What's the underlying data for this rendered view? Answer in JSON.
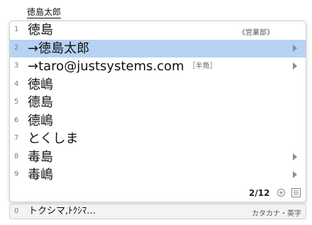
{
  "composition": "徳島太郎",
  "candidates": [
    {
      "num": "1",
      "text": "徳島",
      "annotation": "",
      "note": "《営業部》",
      "has_submenu": false,
      "selected": false
    },
    {
      "num": "2",
      "text": "→徳島太郎",
      "annotation": "",
      "note": "",
      "has_submenu": true,
      "selected": true
    },
    {
      "num": "3",
      "text": "→taro@justsystems.com",
      "annotation": "［半角］",
      "note": "",
      "has_submenu": true,
      "selected": false
    },
    {
      "num": "4",
      "text": "徳嶋",
      "annotation": "",
      "note": "",
      "has_submenu": false,
      "selected": false
    },
    {
      "num": "5",
      "text": "德島",
      "annotation": "",
      "note": "",
      "has_submenu": false,
      "selected": false
    },
    {
      "num": "6",
      "text": "德嶋",
      "annotation": "",
      "note": "",
      "has_submenu": false,
      "selected": false
    },
    {
      "num": "7",
      "text": "とくしま",
      "annotation": "",
      "note": "",
      "has_submenu": false,
      "selected": false
    },
    {
      "num": "8",
      "text": "毒島",
      "annotation": "",
      "note": "",
      "has_submenu": true,
      "selected": false
    },
    {
      "num": "9",
      "text": "毒嶋",
      "annotation": "",
      "note": "",
      "has_submenu": true,
      "selected": false
    }
  ],
  "page_indicator": "2/12",
  "bottom": {
    "num": "0",
    "text": "トクシマ,ﾄｸｼﾏ…",
    "mode": "カタカナ・英字"
  },
  "colors": {
    "selected_row": "#b6d2f4",
    "arrow": "#8c8c8c"
  },
  "icons": [
    "zoom-icon",
    "list-icon",
    "submenu-arrow-icon"
  ]
}
